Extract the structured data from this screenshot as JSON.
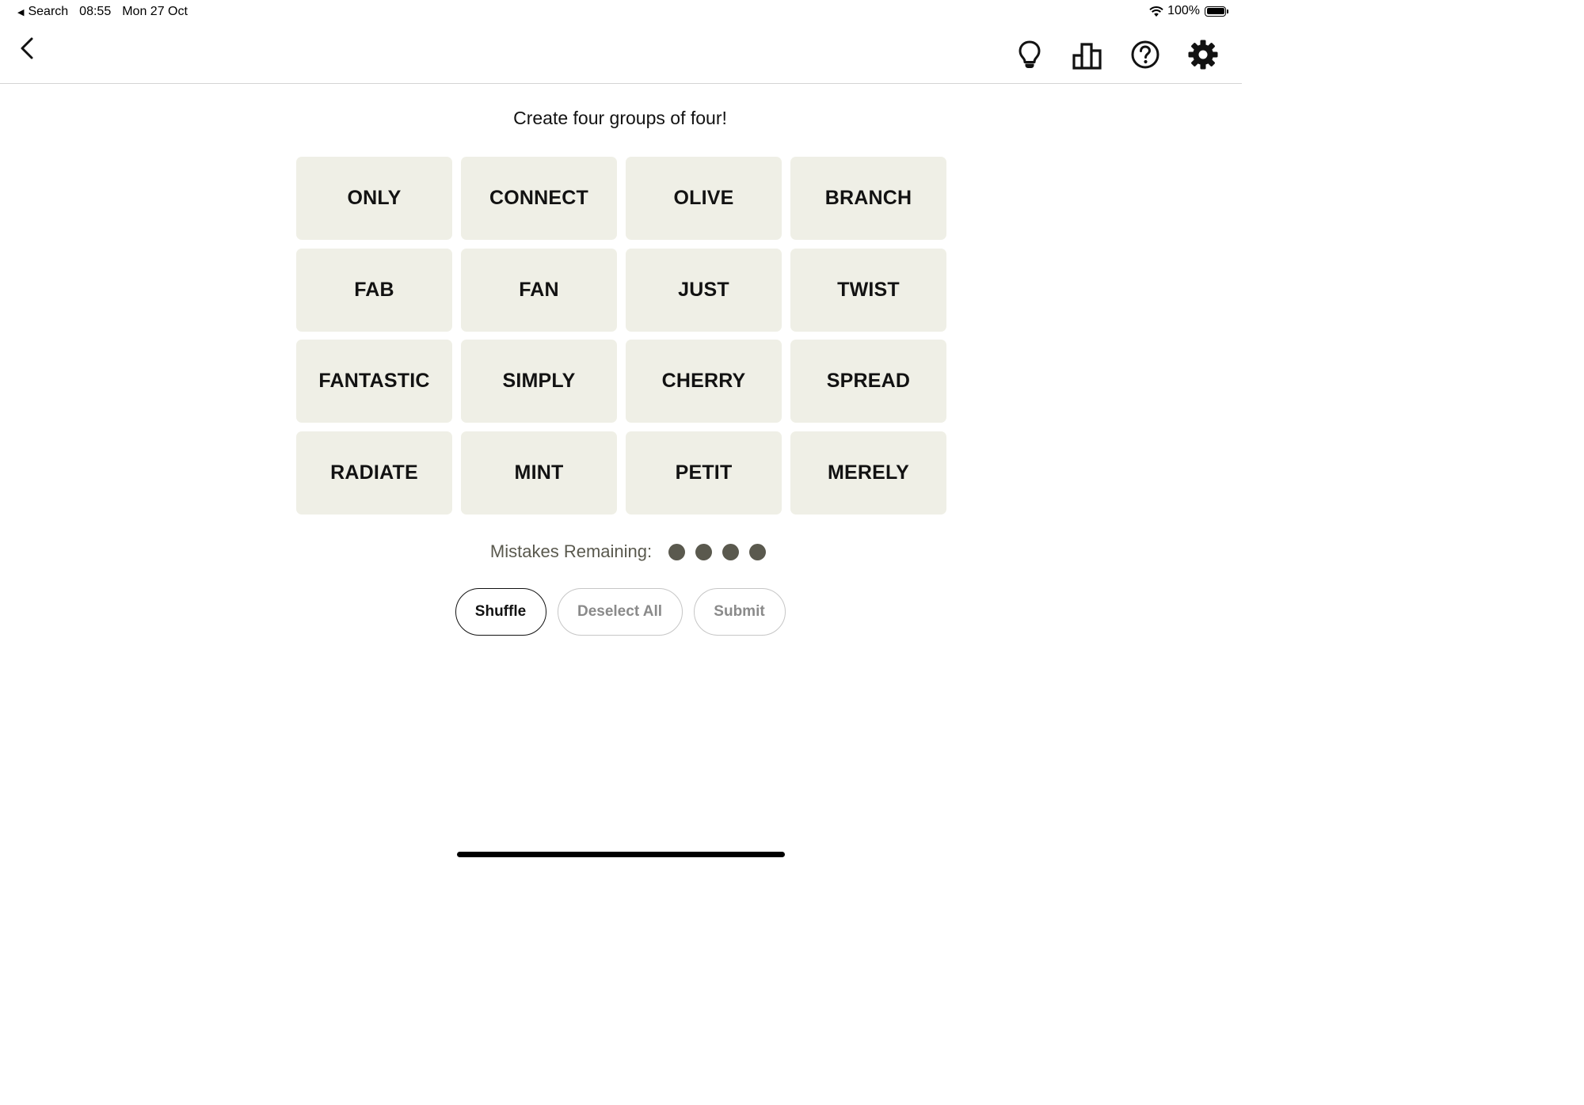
{
  "status_bar": {
    "back_app": "Search",
    "time": "08:55",
    "date": "Mon 27 Oct",
    "battery": "100%",
    "icons": [
      "back-arrow-icon",
      "wifi-icon",
      "battery-icon"
    ]
  },
  "nav": {
    "icons": [
      "chevron-left-icon",
      "lightbulb-icon",
      "leaderboard-icon",
      "help-icon",
      "gear-icon"
    ]
  },
  "prompt": "Create four groups of four!",
  "tiles": [
    "ONLY",
    "CONNECT",
    "OLIVE",
    "BRANCH",
    "FAB",
    "FAN",
    "JUST",
    "TWIST",
    "FANTASTIC",
    "SIMPLY",
    "CHERRY",
    "SPREAD",
    "RADIATE",
    "MINT",
    "PETIT",
    "MERELY"
  ],
  "mistakes": {
    "label": "Mistakes Remaining:",
    "remaining": 4
  },
  "buttons": {
    "shuffle": "Shuffle",
    "deselect_all": "Deselect All",
    "submit": "Submit"
  },
  "colors": {
    "tile_background": "#efefe6",
    "tile_text": "#121212",
    "mistake_dot": "#5a594e",
    "disabled_text": "#8a8a8a"
  }
}
